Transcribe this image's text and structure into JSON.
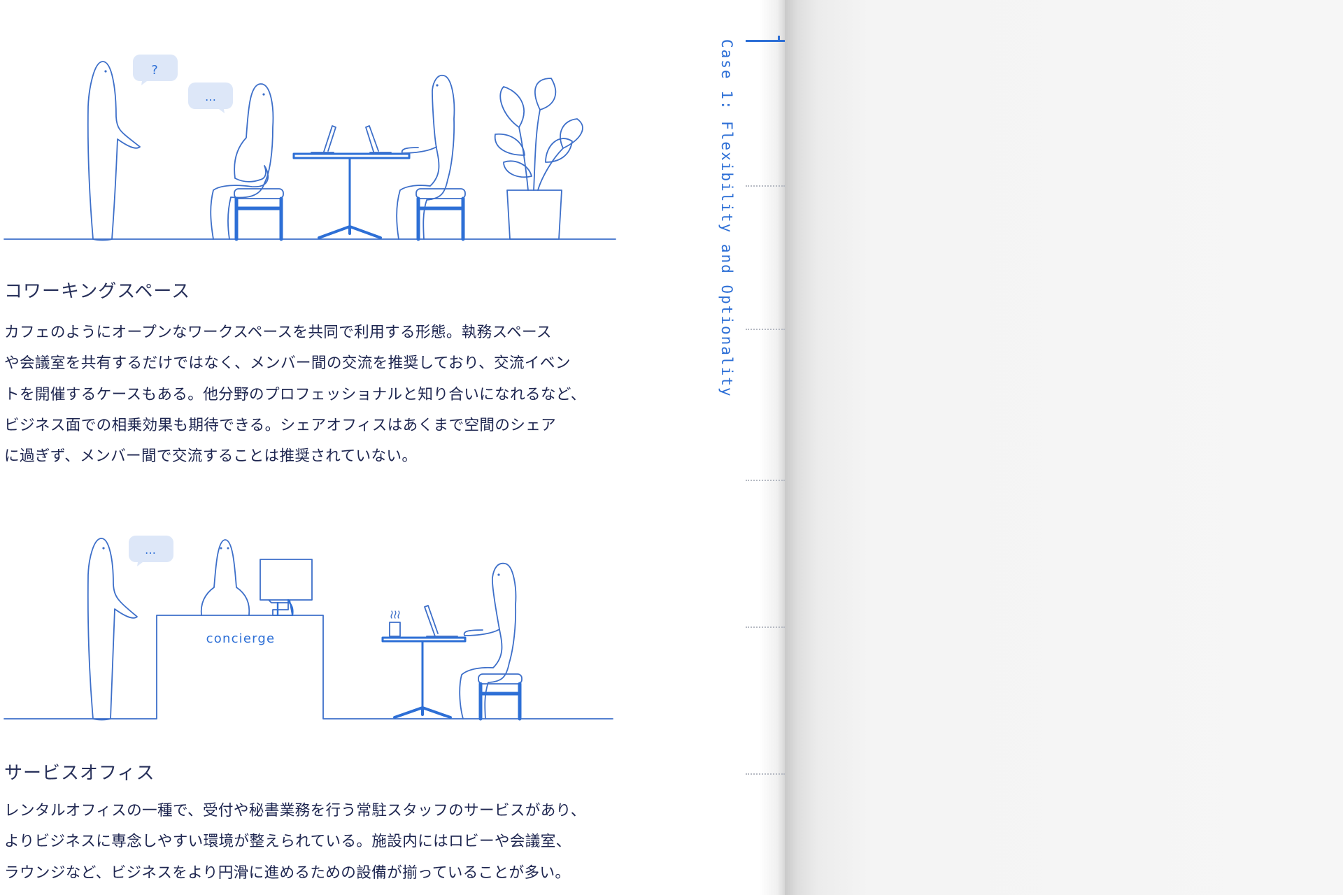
{
  "coworking": {
    "heading": "コワーキングスペース",
    "body_lines": [
      "カフェのようにオープンなワークスペースを共同で利用する形態。執務スペース",
      "や会議室を共有するだけではなく、メンバー間の交流を推奨しており、交流イベン",
      "トを開催するケースもある。他分野のプロフェッショナルと知り合いになれるなど、",
      "ビジネス面での相乗効果も期待できる。シェアオフィスはあくまで空間のシェア",
      "に過ぎず、メンバー間で交流することは推奨されていない。"
    ],
    "bubble_question": "?",
    "bubble_dots": "…"
  },
  "service": {
    "heading": "サービスオフィス",
    "body_lines": [
      "レンタルオフィスの一種で、受付や秘書業務を行う常駐スタッフのサービスがあり、",
      "よりビジネスに専念しやすい環境が整えられている。施設内にはロビーや会議室、",
      "ラウンジなど、ビジネスをより円滑に進めるための設備が揃っていることが多い。"
    ],
    "bubble_dots": "…",
    "desk_label": "concierge"
  },
  "running_head": "Case 1: Flexibility and Optionality",
  "colors": {
    "accent": "#2d6fd6",
    "line": "#3d6fc9",
    "bubble": "#dde7f8",
    "text": "#1e2650"
  }
}
